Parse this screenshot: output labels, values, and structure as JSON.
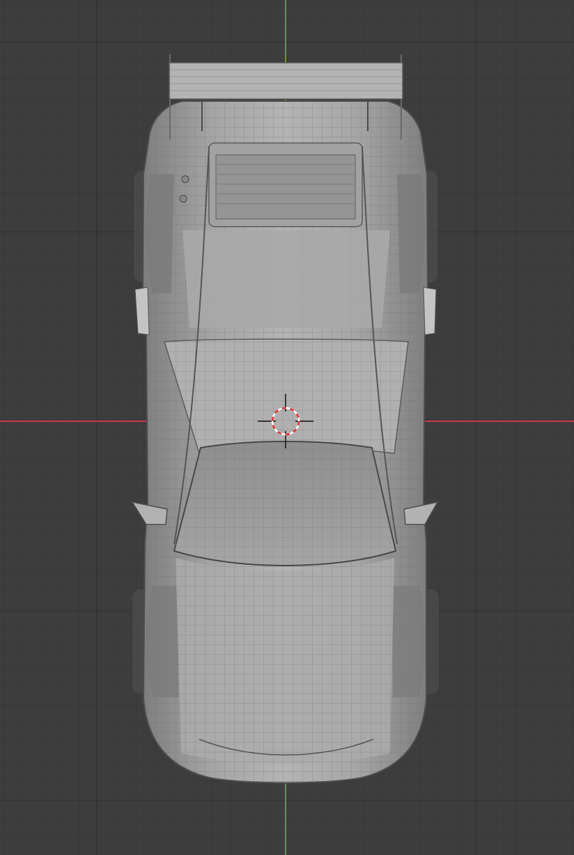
{
  "viewport": {
    "mode": "wireframe-overlay",
    "view": "top-orthographic",
    "object": "sports-car-model",
    "grid": true
  },
  "colors": {
    "background": "#3d3d3d",
    "grid_minor": "#353535",
    "grid_major": "#2e2e2e",
    "x_axis": "#c9394e",
    "y_axis": "#6a9a1f",
    "body_fill": "#9a9a9a",
    "body_light": "#b8b8b8",
    "wire": "#5c5c5c",
    "cursor_red": "#e03030",
    "cursor_white": "#ffffff",
    "cursor_cross": "#111111"
  },
  "icons": {
    "cursor": "3d-cursor-icon"
  }
}
